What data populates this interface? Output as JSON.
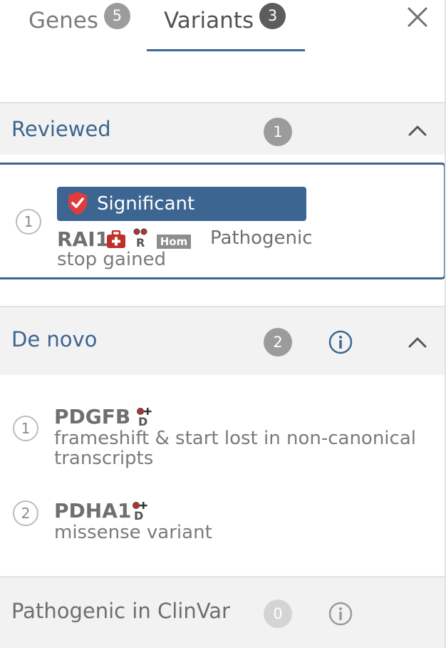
{
  "tabs": {
    "genes_label": "Genes",
    "genes_count": "5",
    "variants_label": "Variants",
    "variants_count": "3",
    "active": "Variants"
  },
  "sections": {
    "reviewed": {
      "title": "Reviewed",
      "count": "1",
      "items": [
        {
          "index": "1",
          "badge": "Significant",
          "gene": "RAI1",
          "inheritance_letter": "R",
          "zygosity": "Hom",
          "classification": "Pathogenic",
          "consequence": "stop gained"
        }
      ]
    },
    "de_novo": {
      "title": "De novo",
      "count": "2",
      "items": [
        {
          "index": "1",
          "gene": "PDGFB",
          "inheritance_letter": "D",
          "consequence_line1": "frameshift & start lost in non-canonical",
          "consequence_line2": "transcripts"
        },
        {
          "index": "2",
          "gene": "PDHA1",
          "inheritance_letter": "D",
          "consequence_line1": "missense variant"
        }
      ]
    },
    "clinvar": {
      "title": "Pathogenic in ClinVar",
      "count": "0"
    }
  },
  "colors": {
    "accent": "#3c6691",
    "significant_shield": "#e03c3c",
    "clinical_icon": "#c0302b",
    "header_bg": "#f2f2f2"
  },
  "icons": [
    "close-icon",
    "chevron-up-icon",
    "info-icon",
    "shield-icon",
    "medical-kit-icon",
    "recessive-icon",
    "de-novo-icon"
  ]
}
